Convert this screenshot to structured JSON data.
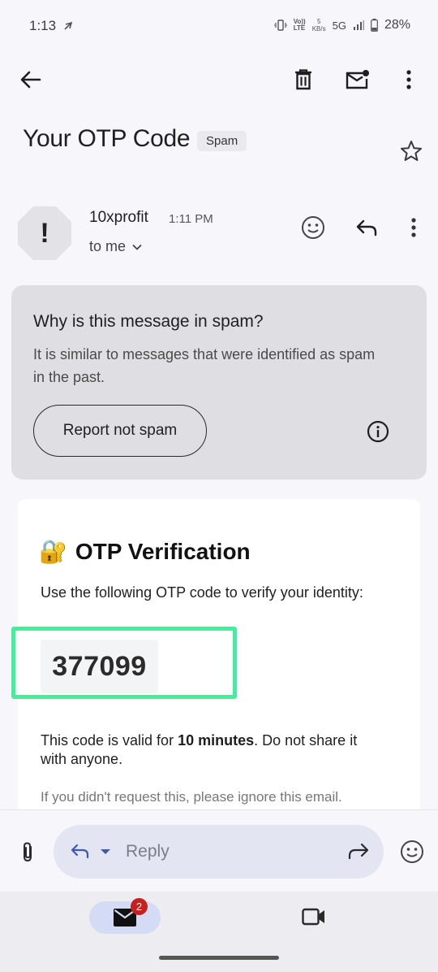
{
  "status_bar": {
    "time": "1:13",
    "network_speed_value": "5",
    "network_speed_unit": "KB/s",
    "network_type": "5G",
    "volte_label": "Vo))",
    "lte_label": "LTE",
    "battery_percent": "28%"
  },
  "email": {
    "subject": "Your OTP Code",
    "label_badge": "Spam",
    "sender_initial": "!",
    "sender_name": "10xprofit",
    "time": "1:11 PM",
    "recipient": "to me"
  },
  "spam_notice": {
    "title": "Why is this message in spam?",
    "description": "It is similar to messages that were identified as spam in the past.",
    "report_button": "Report not spam"
  },
  "body": {
    "heading_emoji": "🔐",
    "heading": "OTP Verification",
    "instructions": "Use the following OTP code to verify your identity:",
    "otp_code": "377099",
    "validity_prefix": "This code is valid for ",
    "validity_duration": "10 minutes",
    "validity_suffix": ". Do not share it with anyone.",
    "ignore_note": "If you didn't request this, please ignore this email."
  },
  "reply_bar": {
    "placeholder": "Reply"
  },
  "bottom_nav": {
    "mail_badge_count": "2"
  },
  "colors": {
    "highlight": "#3ef29b",
    "badge": "#c5221f",
    "mail_pill": "#d4dcf5"
  }
}
